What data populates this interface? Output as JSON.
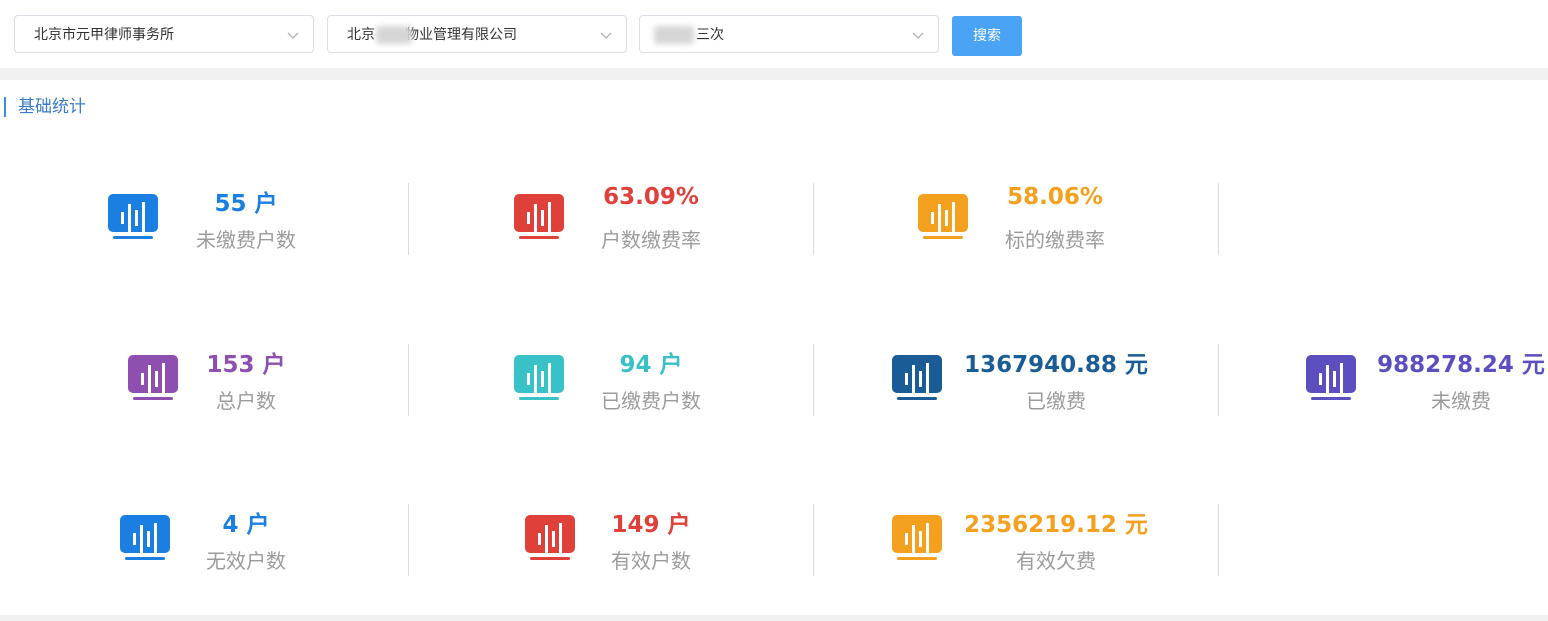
{
  "filters": {
    "firm": "北京市元甲律师事务所",
    "company_prefix": "北京",
    "company_suffix": "物业管理有限公司",
    "batch_suffix": "三次",
    "search_label": "搜索"
  },
  "section": {
    "title": "基础统计"
  },
  "stats": [
    {
      "value": "55 户",
      "label": "未缴费户数",
      "color": "#1a7fe0"
    },
    {
      "value": "63.09%",
      "label": "户数缴费率",
      "color": "#e0403a"
    },
    {
      "value": "58.06%",
      "label": "标的缴费率",
      "color": "#f2a01e"
    },
    {
      "value": "153 户",
      "label": "总户数",
      "color": "#8e4fb0"
    },
    {
      "value": "94 户",
      "label": "已缴费户数",
      "color": "#39c1c8"
    },
    {
      "value": "1367940.88 元",
      "label": "已缴费",
      "color": "#1a5c96"
    },
    {
      "value": "988278.24 元",
      "label": "未缴费",
      "color": "#5b4fc0"
    },
    {
      "value": "4 户",
      "label": "无效户数",
      "color": "#1a7fe0"
    },
    {
      "value": "149 户",
      "label": "有效户数",
      "color": "#e0403a"
    },
    {
      "value": "2356219.12 元",
      "label": "有效欠费",
      "color": "#f2a01e"
    }
  ]
}
